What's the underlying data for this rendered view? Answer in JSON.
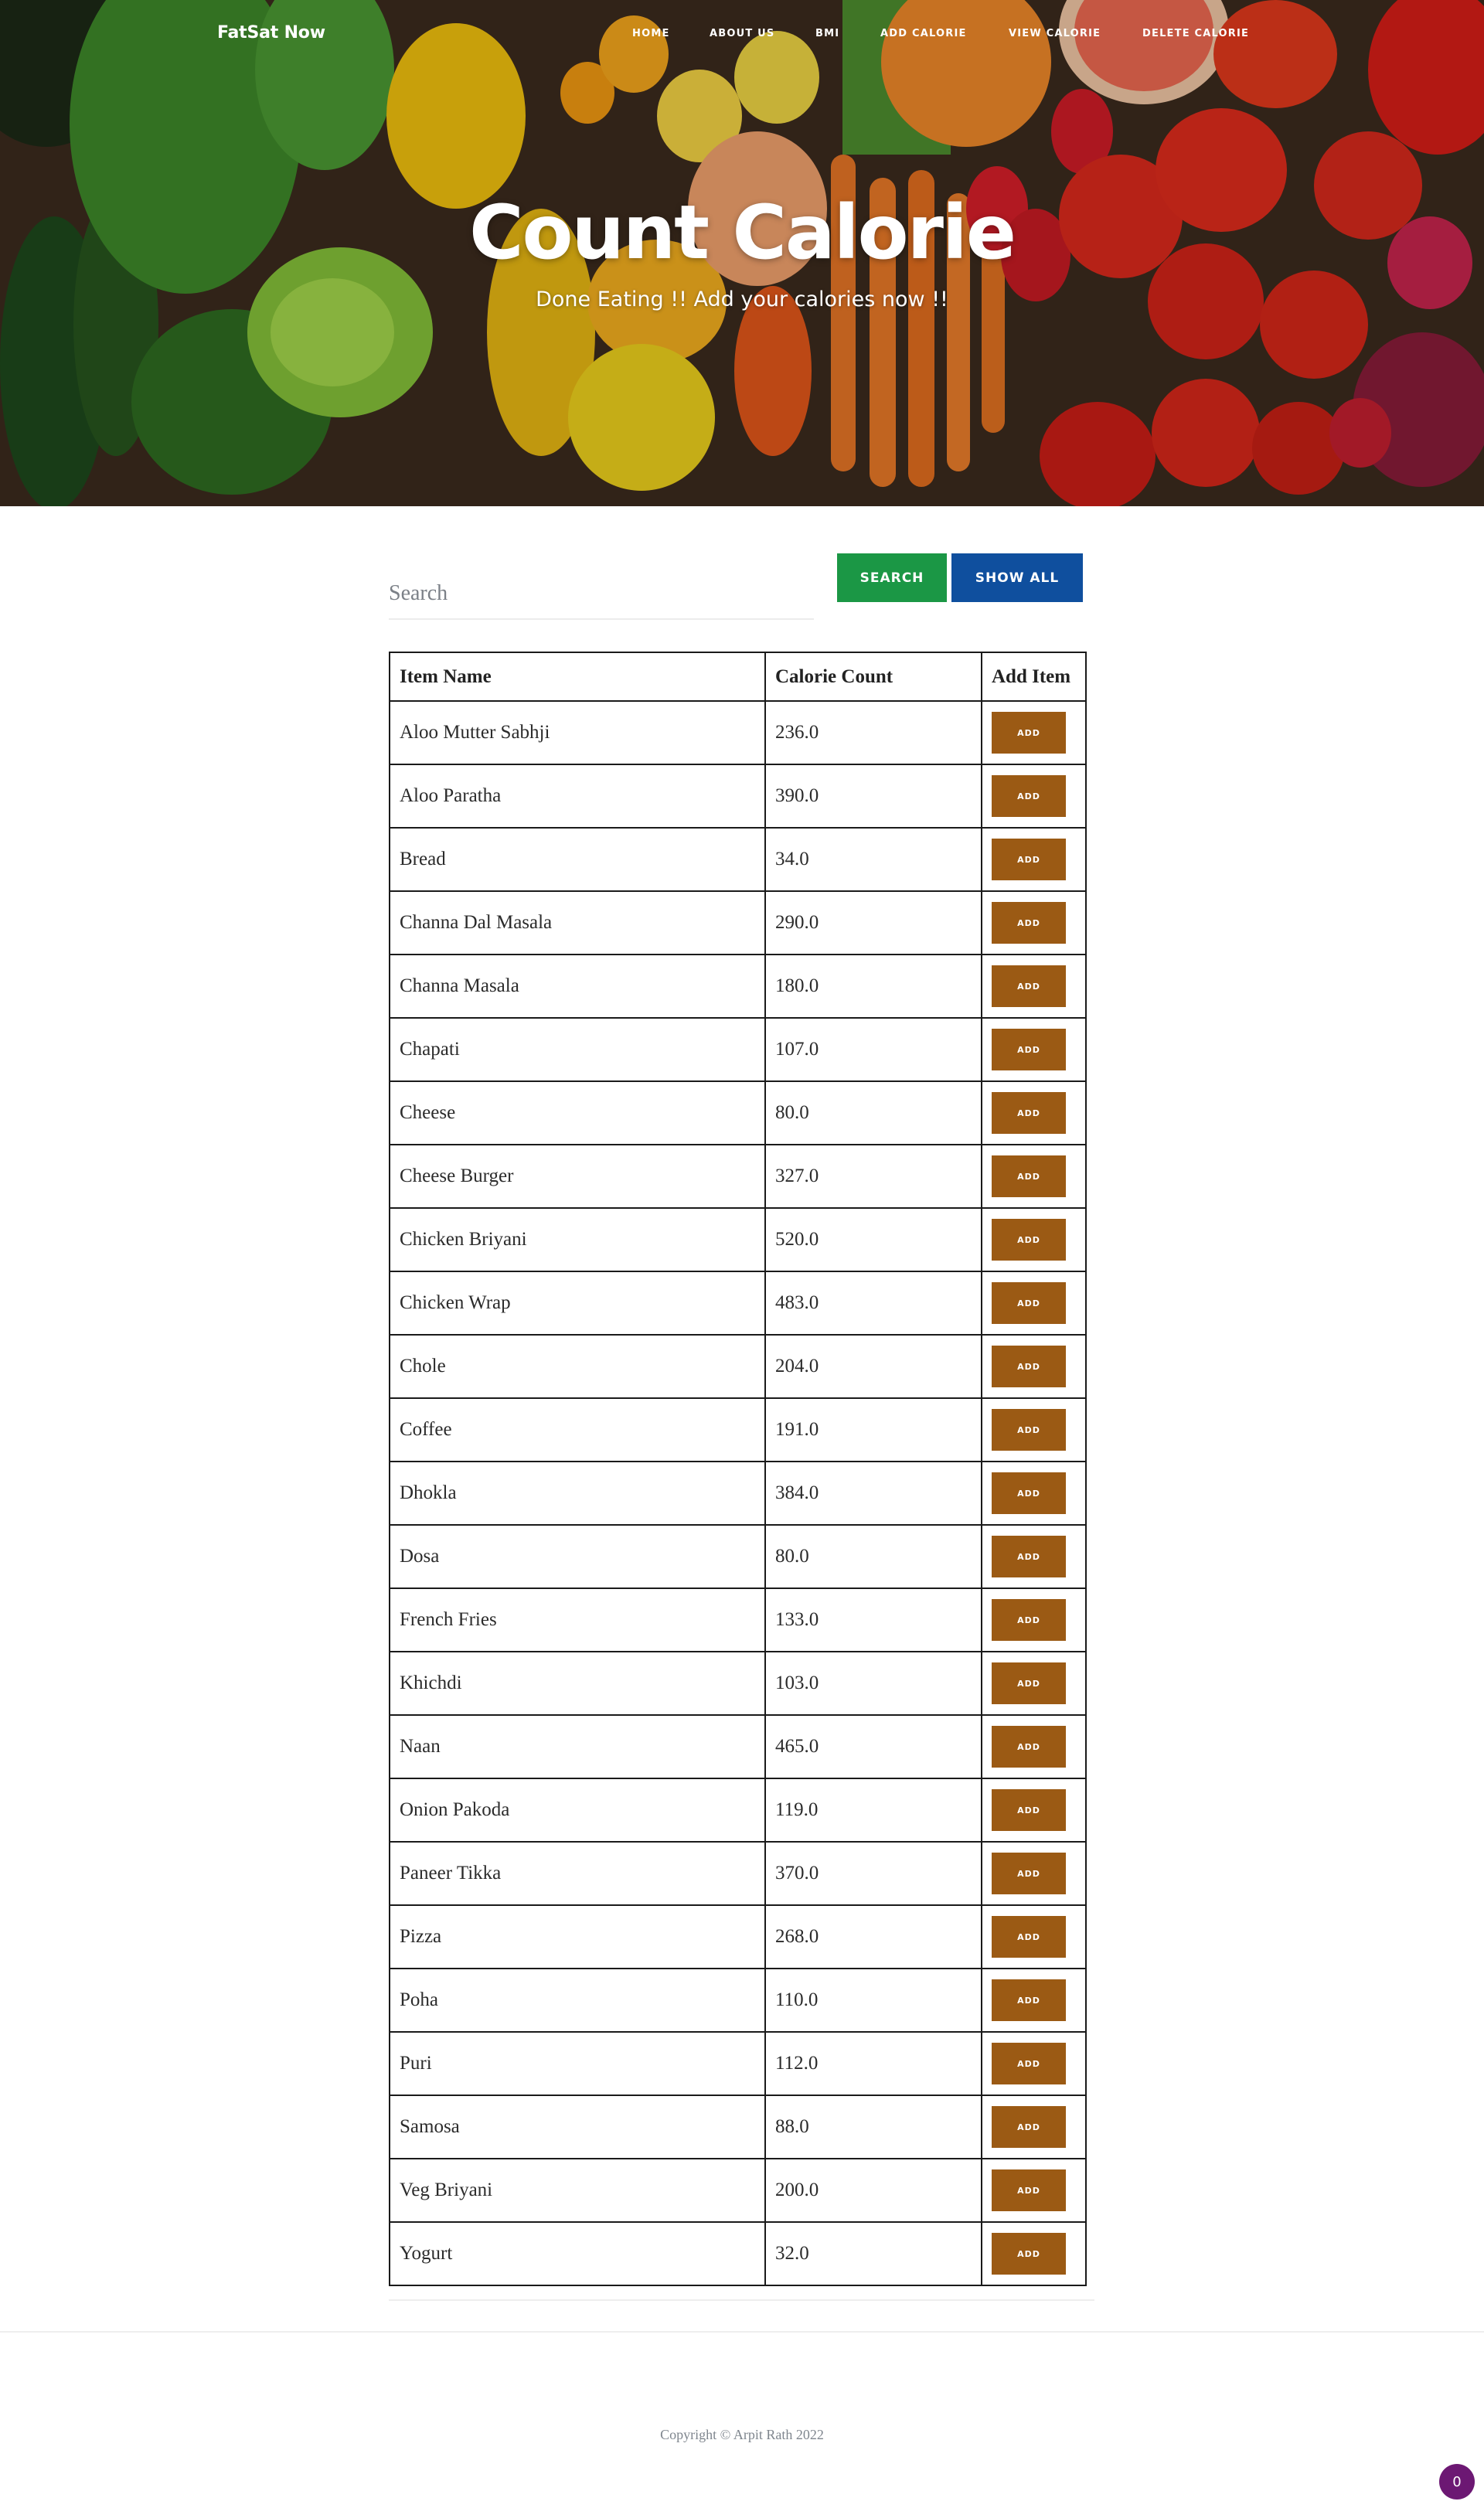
{
  "brand": "FatSat Now",
  "nav": {
    "items": [
      "HOME",
      "ABOUT US",
      "BMI",
      "ADD CALORIE",
      "VIEW CALORIE",
      "DELETE CALORIE"
    ]
  },
  "hero": {
    "title": "Count Calorie",
    "subtitle": "Done Eating !! Add your calories now !!"
  },
  "search": {
    "placeholder": "Search",
    "search_label": "SEARCH",
    "show_all_label": "SHOW ALL"
  },
  "table": {
    "headers": [
      "Item Name",
      "Calorie Count",
      "Add Item"
    ],
    "add_label": "ADD",
    "rows": [
      {
        "name": "Aloo Mutter Sabhji",
        "calories": "236.0"
      },
      {
        "name": "Aloo Paratha",
        "calories": "390.0"
      },
      {
        "name": "Bread",
        "calories": "34.0"
      },
      {
        "name": "Channa Dal Masala",
        "calories": "290.0"
      },
      {
        "name": "Channa Masala",
        "calories": "180.0"
      },
      {
        "name": "Chapati",
        "calories": "107.0"
      },
      {
        "name": "Cheese",
        "calories": "80.0"
      },
      {
        "name": "Cheese Burger",
        "calories": "327.0"
      },
      {
        "name": "Chicken Briyani",
        "calories": "520.0"
      },
      {
        "name": "Chicken Wrap",
        "calories": "483.0"
      },
      {
        "name": "Chole",
        "calories": "204.0"
      },
      {
        "name": "Coffee",
        "calories": "191.0"
      },
      {
        "name": "Dhokla",
        "calories": "384.0"
      },
      {
        "name": "Dosa",
        "calories": "80.0"
      },
      {
        "name": "French Fries",
        "calories": "133.0"
      },
      {
        "name": "Khichdi",
        "calories": "103.0"
      },
      {
        "name": "Naan",
        "calories": "465.0"
      },
      {
        "name": "Onion Pakoda",
        "calories": "119.0"
      },
      {
        "name": "Paneer Tikka",
        "calories": "370.0"
      },
      {
        "name": "Pizza",
        "calories": "268.0"
      },
      {
        "name": "Poha",
        "calories": "110.0"
      },
      {
        "name": "Puri",
        "calories": "112.0"
      },
      {
        "name": "Samosa",
        "calories": "88.0"
      },
      {
        "name": "Veg Briyani",
        "calories": "200.0"
      },
      {
        "name": "Yogurt",
        "calories": "32.0"
      }
    ]
  },
  "footer": {
    "copyright": "Copyright © Arpit Rath 2022",
    "badge_count": "0"
  },
  "colors": {
    "search_button": "#1b9745",
    "show_all_button": "#0f4f9e",
    "add_button": "#9b5a14",
    "badge": "#6c1873"
  }
}
